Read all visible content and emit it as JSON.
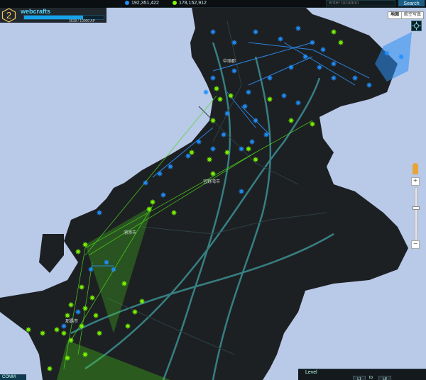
{
  "topbar": {
    "score_resistance": "192,351,422",
    "score_enlightened": "178,152,912",
    "search_placeholder": "enter location",
    "search_button_label": "Search"
  },
  "player": {
    "level": "2",
    "name": "webcrafts",
    "ap_progress": 0.74,
    "ap_text": "3638 / 10000 AP"
  },
  "map_type": {
    "options": [
      "地図",
      "航空写真"
    ],
    "selected": "地図"
  },
  "map": {
    "place_labels": [
      "中頭郡",
      "宜野湾市",
      "浦添市",
      "那覇市"
    ],
    "colors": {
      "land": "#1d2023",
      "water": "#b9c9e8",
      "road": "#3a8a8d",
      "resistance": "#1e90ff",
      "enlightened": "#7cfc00"
    }
  },
  "bottom": {
    "comm_label": "COMM",
    "level_label": "Level",
    "level_from": "L1",
    "level_to_label": "to",
    "level_to": "L8"
  },
  "zoom": {
    "in_label": "+",
    "out_label": "−"
  }
}
